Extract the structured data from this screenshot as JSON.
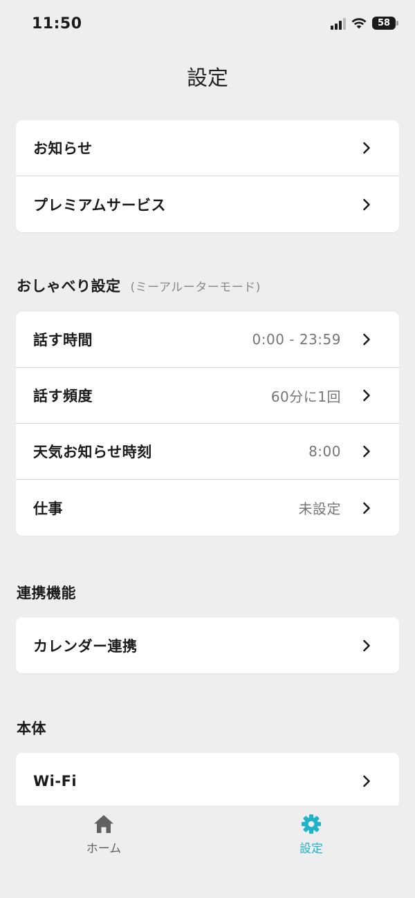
{
  "status_bar": {
    "time": "11:50",
    "battery": "58"
  },
  "header": {
    "title": "設定"
  },
  "general": {
    "items": [
      {
        "label": "お知らせ"
      },
      {
        "label": "プレミアムサービス"
      }
    ]
  },
  "chat_settings": {
    "title": "おしゃべり設定",
    "subtitle": "(ミーアルーターモード)",
    "items": [
      {
        "label": "話す時間",
        "value": "0:00 - 23:59"
      },
      {
        "label": "話す頻度",
        "value": "60分に1回"
      },
      {
        "label": "天気お知らせ時刻",
        "value": "8:00"
      },
      {
        "label": "仕事",
        "value": "未設定"
      }
    ]
  },
  "integrations": {
    "title": "連携機能",
    "items": [
      {
        "label": "カレンダー連携"
      }
    ]
  },
  "device": {
    "title": "本体",
    "items": [
      {
        "label": "Wi-Fi"
      }
    ]
  },
  "tab_bar": {
    "home": {
      "label": "ホーム",
      "icon": "home-icon",
      "color": "#616161"
    },
    "settings": {
      "label": "設定",
      "icon": "gear-icon",
      "color": "#1fb3c9",
      "active": true
    }
  }
}
